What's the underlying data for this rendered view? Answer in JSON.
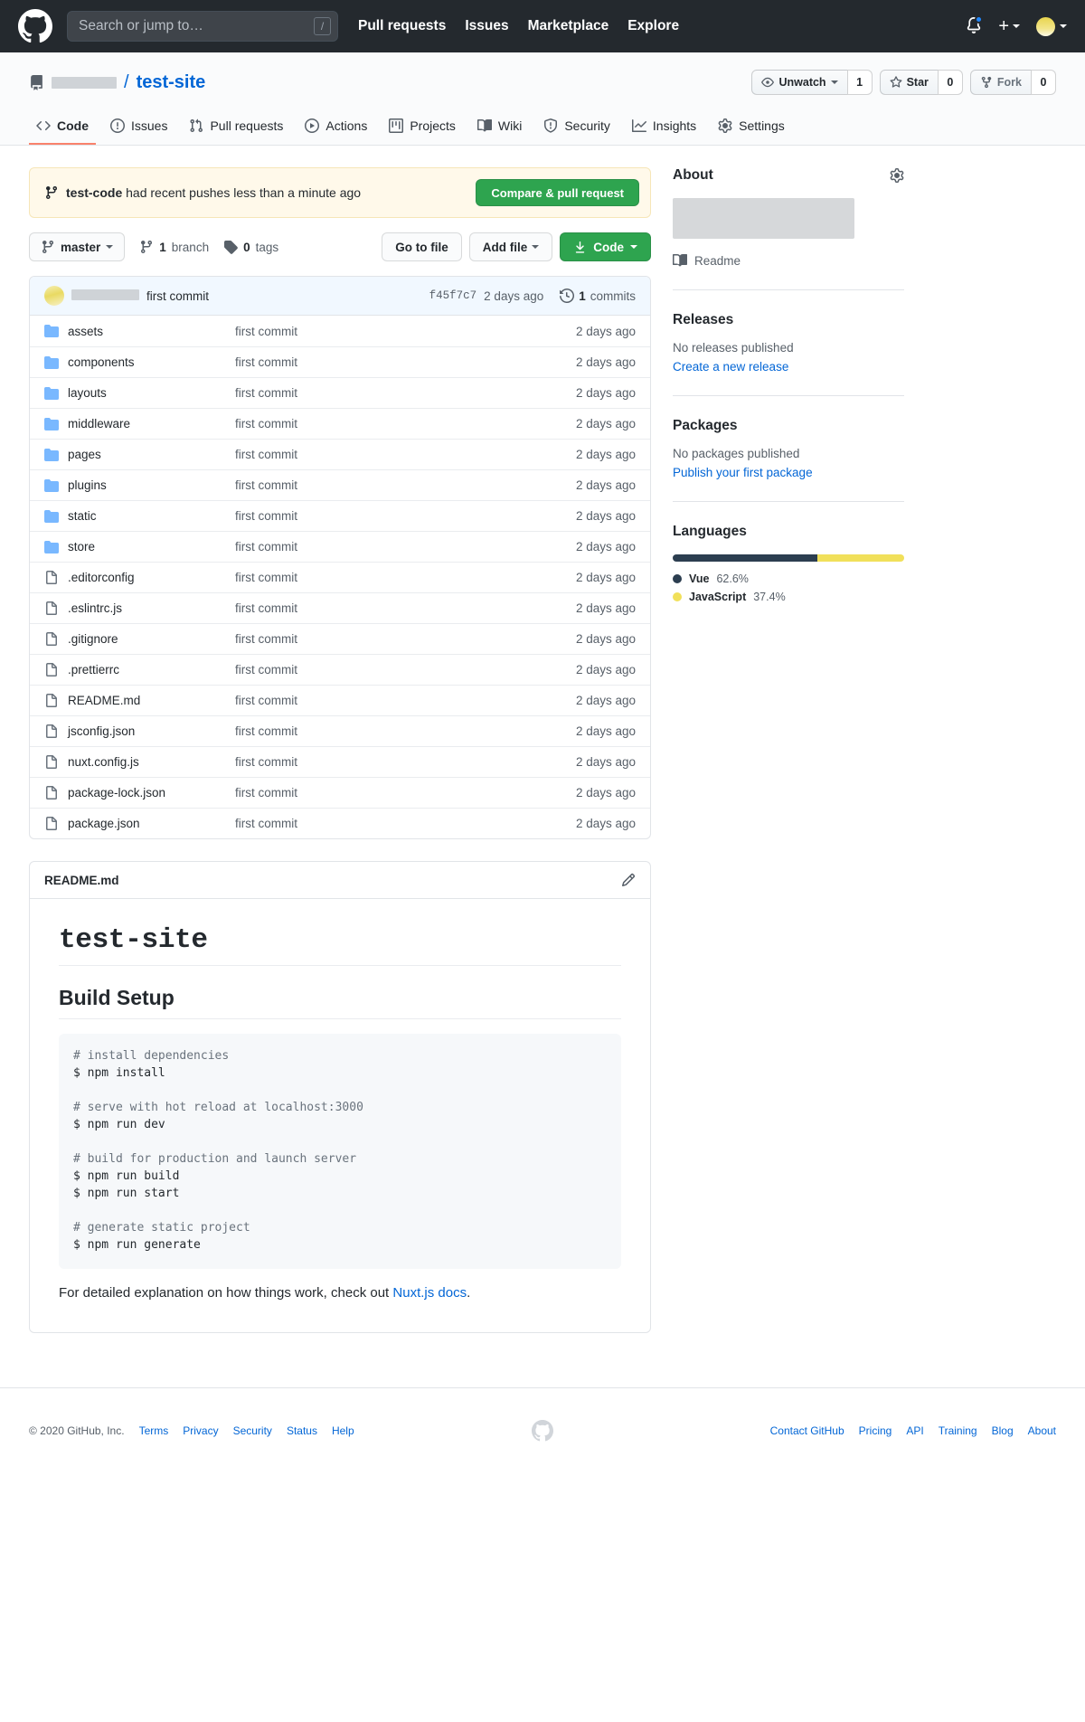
{
  "topbar": {
    "logo_icon": "github-mark-icon",
    "search": {
      "placeholder": "Search or jump to…",
      "value": "",
      "shortcut": "/"
    },
    "nav": [
      {
        "label": "Pull requests"
      },
      {
        "label": "Issues"
      },
      {
        "label": "Marketplace"
      },
      {
        "label": "Explore"
      }
    ],
    "notifications_icon": "bell-icon",
    "create_new_icon": "plus-icon",
    "profile_icon": "avatar-icon"
  },
  "repo": {
    "repo_icon": "repository-icon",
    "owner": "",
    "separator": "/",
    "name": "test-site",
    "actions": {
      "watch_label": "Unwatch",
      "watch_count": "1",
      "star_label": "Star",
      "star_count": "0",
      "fork_label": "Fork",
      "fork_count": "0"
    },
    "tabs": [
      {
        "label": "Code",
        "icon": "code-icon",
        "active": true
      },
      {
        "label": "Issues",
        "icon": "issue-opened-icon",
        "active": false
      },
      {
        "label": "Pull requests",
        "icon": "git-pull-request-icon",
        "active": false
      },
      {
        "label": "Actions",
        "icon": "play-icon",
        "active": false
      },
      {
        "label": "Projects",
        "icon": "project-icon",
        "active": false
      },
      {
        "label": "Wiki",
        "icon": "book-icon",
        "active": false
      },
      {
        "label": "Security",
        "icon": "shield-icon",
        "active": false
      },
      {
        "label": "Insights",
        "icon": "graph-icon",
        "active": false
      },
      {
        "label": "Settings",
        "icon": "gear-icon",
        "active": false
      }
    ]
  },
  "push_banner": {
    "icon": "git-branch-icon",
    "branch": "test-code",
    "text": " had recent pushes less than a minute ago",
    "button_label": "Compare & pull request"
  },
  "branch_toolbar": {
    "branch_name": "master",
    "branch_icon": "git-branch-icon",
    "branches_count": "1",
    "branches_label": "branch",
    "tags_count": "0",
    "tags_label": "tags",
    "tag_icon": "tag-icon",
    "go_to_file": "Go to file",
    "add_file": "Add file",
    "code_label": "Code",
    "download_icon": "download-icon"
  },
  "latest_commit": {
    "author": "",
    "message": "first commit",
    "sha": "f45f7c7",
    "age": "2 days ago",
    "commits_count": "1",
    "commits_label": "commits",
    "history_icon": "history-icon"
  },
  "files": [
    {
      "name": "assets",
      "type": "dir",
      "commit": "first commit",
      "age": "2 days ago"
    },
    {
      "name": "components",
      "type": "dir",
      "commit": "first commit",
      "age": "2 days ago"
    },
    {
      "name": "layouts",
      "type": "dir",
      "commit": "first commit",
      "age": "2 days ago"
    },
    {
      "name": "middleware",
      "type": "dir",
      "commit": "first commit",
      "age": "2 days ago"
    },
    {
      "name": "pages",
      "type": "dir",
      "commit": "first commit",
      "age": "2 days ago"
    },
    {
      "name": "plugins",
      "type": "dir",
      "commit": "first commit",
      "age": "2 days ago"
    },
    {
      "name": "static",
      "type": "dir",
      "commit": "first commit",
      "age": "2 days ago"
    },
    {
      "name": "store",
      "type": "dir",
      "commit": "first commit",
      "age": "2 days ago"
    },
    {
      "name": ".editorconfig",
      "type": "file",
      "commit": "first commit",
      "age": "2 days ago"
    },
    {
      "name": ".eslintrc.js",
      "type": "file",
      "commit": "first commit",
      "age": "2 days ago"
    },
    {
      "name": ".gitignore",
      "type": "file",
      "commit": "first commit",
      "age": "2 days ago"
    },
    {
      "name": ".prettierrc",
      "type": "file",
      "commit": "first commit",
      "age": "2 days ago"
    },
    {
      "name": "README.md",
      "type": "file",
      "commit": "first commit",
      "age": "2 days ago"
    },
    {
      "name": "jsconfig.json",
      "type": "file",
      "commit": "first commit",
      "age": "2 days ago"
    },
    {
      "name": "nuxt.config.js",
      "type": "file",
      "commit": "first commit",
      "age": "2 days ago"
    },
    {
      "name": "package-lock.json",
      "type": "file",
      "commit": "first commit",
      "age": "2 days ago"
    },
    {
      "name": "package.json",
      "type": "file",
      "commit": "first commit",
      "age": "2 days ago"
    }
  ],
  "readme": {
    "filename": "README.md",
    "edit_icon": "pencil-icon",
    "h1": "test-site",
    "h2": "Build Setup",
    "code": "# install dependencies\n$ npm install\n\n# serve with hot reload at localhost:3000\n$ npm run dev\n\n# build for production and launch server\n$ npm run build\n$ npm run start\n\n# generate static project\n$ npm run generate",
    "footer_text_before": "For detailed explanation on how things work, check out ",
    "footer_link": "Nuxt.js docs",
    "footer_text_after": "."
  },
  "sidebar": {
    "about": {
      "title": "About",
      "settings_icon": "gear-icon",
      "description": "",
      "readme_label": "Readme",
      "readme_icon": "book-icon"
    },
    "releases": {
      "title": "Releases",
      "empty_text": "No releases published",
      "link_label": "Create a new release"
    },
    "packages": {
      "title": "Packages",
      "empty_text": "No packages published",
      "link_label": "Publish your first package"
    },
    "languages": {
      "title": "Languages",
      "items": [
        {
          "name": "Vue",
          "percent": "62.6%",
          "value": 62.6,
          "color": "#2c3e50"
        },
        {
          "name": "JavaScript",
          "percent": "37.4%",
          "value": 37.4,
          "color": "#f1e05a"
        }
      ]
    }
  },
  "footer": {
    "copyright": "© 2020 GitHub, Inc.",
    "logo_icon": "github-mark-icon",
    "left_links": [
      {
        "label": "Terms"
      },
      {
        "label": "Privacy"
      },
      {
        "label": "Security"
      },
      {
        "label": "Status"
      },
      {
        "label": "Help"
      }
    ],
    "right_links": [
      {
        "label": "Contact GitHub"
      },
      {
        "label": "Pricing"
      },
      {
        "label": "API"
      },
      {
        "label": "Training"
      },
      {
        "label": "Blog"
      },
      {
        "label": "About"
      }
    ]
  }
}
